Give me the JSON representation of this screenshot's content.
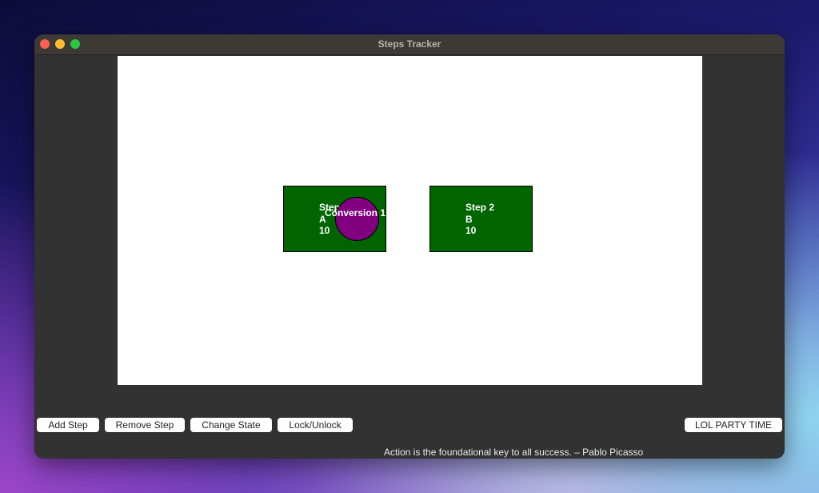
{
  "window": {
    "title": "Steps Tracker"
  },
  "canvas": {
    "steps": [
      {
        "text": "Step 1\nA\n10",
        "name": "Step 1",
        "state": "A",
        "value": "10",
        "color": "#006400"
      },
      {
        "text": "Step 2\nB\n10",
        "name": "Step 2",
        "state": "B",
        "value": "10",
        "color": "#006400"
      }
    ],
    "conversion": {
      "label": "Conversion 1",
      "color": "#800080"
    }
  },
  "toolbar": {
    "add_step": "Add Step",
    "remove_step": "Remove Step",
    "change_state": "Change State",
    "lock_unlock": "Lock/Unlock",
    "party": "LOL PARTY TIME"
  },
  "footer": {
    "quote": "Action is the foundational key to all success. – Pablo Picasso"
  }
}
